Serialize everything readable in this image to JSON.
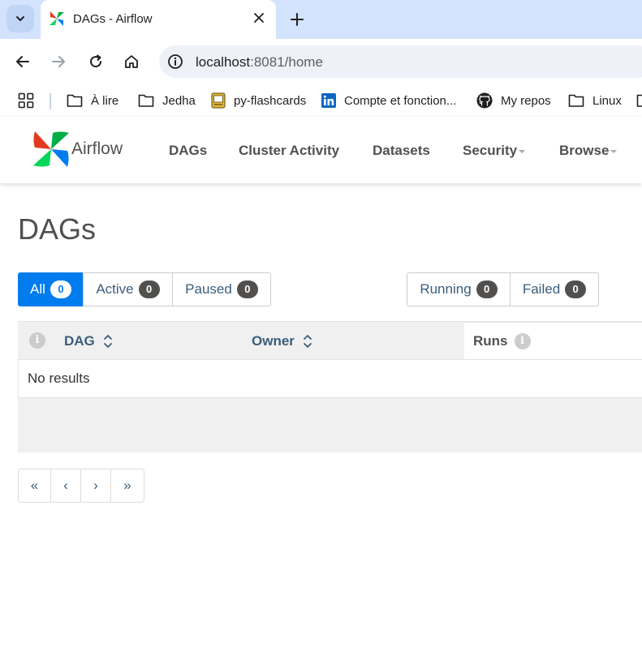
{
  "browser": {
    "tab": {
      "title": "DAGs - Airflow",
      "favicon": "airflow-pinwheel-icon"
    },
    "address_bar": {
      "host": "localhost",
      "path": ":8081/home"
    },
    "bookmarks": [
      {
        "label": "À lire",
        "icon": "folder-icon"
      },
      {
        "label": "Jedha",
        "icon": "folder-icon"
      },
      {
        "label": "py-flashcards",
        "icon": "flashcards-icon"
      },
      {
        "label": "Compte et fonction...",
        "icon": "linkedin-icon"
      },
      {
        "label": "My repos",
        "icon": "github-icon"
      },
      {
        "label": "Linux",
        "icon": "folder-icon"
      }
    ]
  },
  "navbar": {
    "brand": "Airflow",
    "items": [
      {
        "label": "DAGs",
        "dropdown": false
      },
      {
        "label": "Cluster Activity",
        "dropdown": false
      },
      {
        "label": "Datasets",
        "dropdown": false
      },
      {
        "label": "Security",
        "dropdown": true
      },
      {
        "label": "Browse",
        "dropdown": true
      }
    ]
  },
  "page": {
    "title": "DAGs",
    "status_filters": [
      {
        "label": "All",
        "count": "0",
        "active": true
      },
      {
        "label": "Active",
        "count": "0",
        "active": false
      },
      {
        "label": "Paused",
        "count": "0",
        "active": false
      }
    ],
    "run_filters": [
      {
        "label": "Running",
        "count": "0"
      },
      {
        "label": "Failed",
        "count": "0"
      }
    ],
    "table": {
      "columns": [
        {
          "label": "DAG",
          "sortable": true
        },
        {
          "label": "Owner",
          "sortable": true
        },
        {
          "label": "Runs",
          "info": true
        }
      ],
      "empty_message": "No results"
    },
    "pagination": [
      "«",
      "‹",
      "›",
      "»"
    ]
  },
  "colors": {
    "accent": "#017cee",
    "text": "#51504f",
    "link": "#3b5d7c",
    "badge": "#51504f"
  }
}
